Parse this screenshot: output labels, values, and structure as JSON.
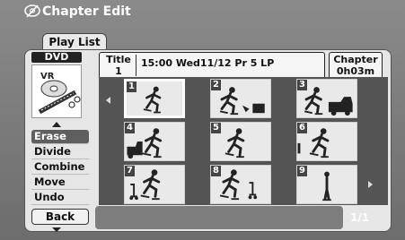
{
  "header": {
    "title": "Chapter Edit",
    "icon": "disc-edit-icon"
  },
  "tab": {
    "label": "Play List"
  },
  "left_panel": {
    "media": "DVD",
    "disc_label": "VR",
    "menu_items": [
      "Erase",
      "Divide",
      "Combine",
      "Move",
      "Undo"
    ],
    "selected_menu": "Erase",
    "back_label": "Back"
  },
  "info": {
    "title_label": "Title",
    "title_number": "1",
    "details": "15:00 Wed11/12  Pr 5   LP",
    "chapter_label": "Chapter",
    "chapter_time": "0h03m"
  },
  "thumbnails": [
    {
      "num": "1",
      "selected": true
    },
    {
      "num": "2",
      "selected": false
    },
    {
      "num": "3",
      "selected": false
    },
    {
      "num": "4",
      "selected": false
    },
    {
      "num": "5",
      "selected": false
    },
    {
      "num": "6",
      "selected": false
    },
    {
      "num": "7",
      "selected": false
    },
    {
      "num": "8",
      "selected": false
    },
    {
      "num": "9",
      "selected": false
    }
  ],
  "page_indicator": "1/1"
}
